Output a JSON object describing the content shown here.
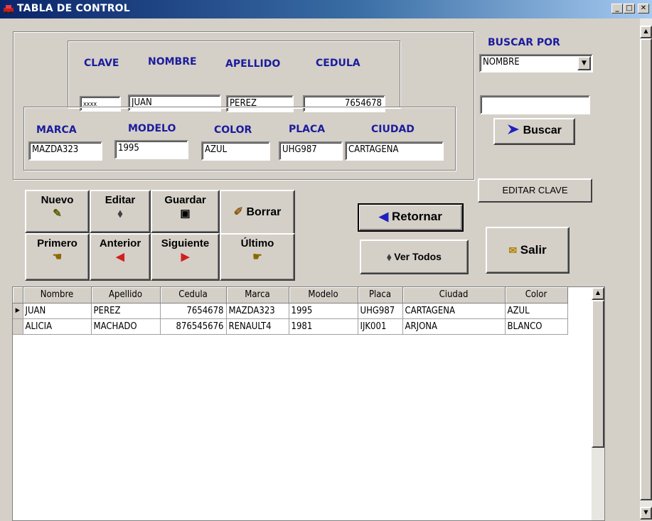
{
  "window": {
    "title": "TABLA DE CONTROL",
    "app_icon": "car-icon",
    "minimize_glyph": "_",
    "maximize_glyph": "□",
    "close_glyph": "✕"
  },
  "person": {
    "clave_label": "CLAVE",
    "clave_value": "xxxx",
    "nombre_label": "NOMBRE",
    "nombre_value": "JUAN",
    "apellido_label": "APELLIDO",
    "apellido_value": "PEREZ",
    "cedula_label": "CEDULA",
    "cedula_value": "7654678"
  },
  "vehicle": {
    "marca_label": "MARCA",
    "marca_value": "MAZDA323",
    "modelo_label": "MODELO",
    "modelo_value": "1995",
    "color_label": "COLOR",
    "color_value": "AZUL",
    "placa_label": "PLACA",
    "placa_value": "UHG987",
    "ciudad_label": "CIUDAD",
    "ciudad_value": "CARTAGENA"
  },
  "search": {
    "label": "BUSCAR POR",
    "selected": "NOMBRE",
    "text_value": "",
    "button": "Buscar"
  },
  "buttons": {
    "nuevo": "Nuevo",
    "editar": "Editar",
    "guardar": "Guardar",
    "borrar": "Borrar",
    "primero": "Primero",
    "anterior": "Anterior",
    "siguiente": "Siguiente",
    "ultimo": "Último",
    "retornar": "Retornar",
    "ver_todos": "Ver Todos",
    "editar_clave": "EDITAR CLAVE",
    "salir": "Salir"
  },
  "grid": {
    "columns": [
      "Nombre",
      "Apellido",
      "Cedula",
      "Marca",
      "Modelo",
      "Placa",
      "Ciudad",
      "Color"
    ],
    "rows": [
      [
        "JUAN",
        "PEREZ",
        "7654678",
        "MAZDA323",
        "1995",
        "UHG987",
        "CARTAGENA",
        "AZUL"
      ],
      [
        "ALICIA",
        "MACHADO",
        "876545676",
        "RENAULT4",
        "1981",
        "IJK001",
        "ARJONA",
        "BLANCO"
      ]
    ],
    "current_row_indicator": "▶"
  },
  "colors": {
    "label_blue": "#1c1c9c",
    "title_gradient_start": "#0a246a",
    "title_gradient_end": "#a6caf0",
    "face": "#d4d0c8"
  }
}
